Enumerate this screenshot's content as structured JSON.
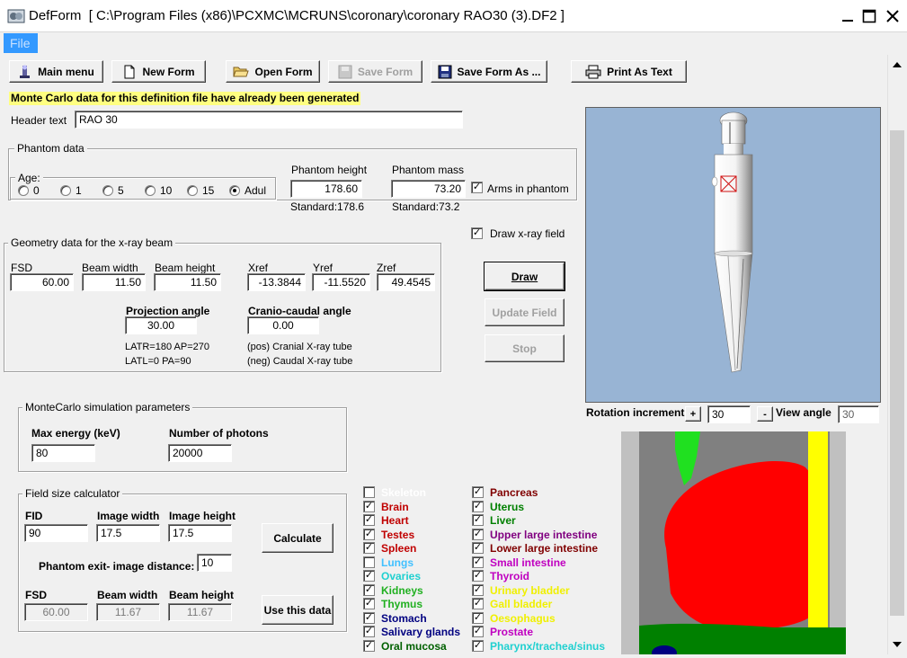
{
  "window": {
    "app_name": "DefForm",
    "path": "[ C:\\Program Files (x86)\\PCXMC\\MCRUNS\\coronary\\coronary RAO30 (3).DF2 ]"
  },
  "menu": {
    "file": "File"
  },
  "toolbar": {
    "main_menu": "Main menu",
    "new_form": "New Form",
    "open_form": "Open Form",
    "save_form": "Save Form",
    "save_form_as": "Save Form As ...",
    "print_as_text": "Print As Text"
  },
  "notice": "Monte Carlo data for this definition file have already been  generated",
  "header": {
    "label": "Header text",
    "value": "RAO 30"
  },
  "phantom": {
    "group_label": "Phantom data",
    "age_label": "Age:",
    "ages": [
      {
        "label": "0",
        "selected": false
      },
      {
        "label": "1",
        "selected": false
      },
      {
        "label": "5",
        "selected": false
      },
      {
        "label": "10",
        "selected": false
      },
      {
        "label": "15",
        "selected": false
      },
      {
        "label": "Adul",
        "selected": true
      }
    ],
    "height_label": "Phantom height",
    "height_value": "178.60",
    "height_standard": "Standard:178.6",
    "mass_label": "Phantom mass",
    "mass_value": "73.20",
    "mass_standard": "Standard:73.2",
    "arms_label": "Arms in phantom",
    "arms_checked": true
  },
  "draw_xray_field": {
    "label": "Draw x-ray field",
    "checked": true
  },
  "geometry": {
    "group_label": "Geometry data for the x-ray beam",
    "fsd_label": "FSD",
    "fsd_value": "60.00",
    "beam_width_label": "Beam width",
    "beam_width_value": "11.50",
    "beam_height_label": "Beam height",
    "beam_height_value": "11.50",
    "xref_label": "Xref",
    "xref_value": "-13.3844",
    "yref_label": "Yref",
    "yref_value": "-11.5520",
    "zref_label": "Zref",
    "zref_value": "49.4545",
    "proj_label": "Projection angle",
    "proj_value": "30.00",
    "cc_label": "Cranio-caudal angle",
    "cc_value": "0.00",
    "note1": "LATR=180  AP=270",
    "note2": "LATL=0      PA=90",
    "note3": "(pos) Cranial X-ray tube",
    "note4": "(neg) Caudal X-ray tube"
  },
  "buttons": {
    "draw": "Draw",
    "update_field": "Update Field",
    "stop": "Stop"
  },
  "view": {
    "rotation_label": "Rotation increment",
    "plus": "+",
    "rotation_value": "30",
    "minus": "-",
    "view_angle_label": "View angle",
    "view_angle_value": "30",
    "bg_color": "#98b4d4"
  },
  "montecarlo": {
    "group_label": "MonteCarlo simulation parameters",
    "energy_label": "Max energy (keV)",
    "energy_value": "80",
    "photons_label": "Number of photons",
    "photons_value": "20000"
  },
  "fieldsize": {
    "group_label": "Field size calculator",
    "fid_label": "FID",
    "fid_value": "90",
    "img_w_label": "Image width",
    "img_w_value": "17.5",
    "img_h_label": "Image height",
    "img_h_value": "17.5",
    "calculate": "Calculate",
    "exit_label": "Phantom exit- image distance:",
    "exit_value": "10",
    "fsd_label": "FSD",
    "fsd_value": "60.00",
    "bw_label": "Beam width",
    "bw_value": "11.67",
    "bh_label": "Beam height",
    "bh_value": "11.67",
    "use_data": "Use this data"
  },
  "organs_left": [
    {
      "name": "Skeleton",
      "color": "#ffffff",
      "checked": false
    },
    {
      "name": "Brain",
      "color": "#c00000",
      "checked": true
    },
    {
      "name": "Heart",
      "color": "#c00000",
      "checked": true
    },
    {
      "name": "Testes",
      "color": "#c00000",
      "checked": true
    },
    {
      "name": "Spleen",
      "color": "#c00000",
      "checked": true
    },
    {
      "name": "Lungs",
      "color": "#40c0ff",
      "checked": false
    },
    {
      "name": "Ovaries",
      "color": "#20d0d0",
      "checked": true
    },
    {
      "name": "Kidneys",
      "color": "#20b020",
      "checked": true
    },
    {
      "name": "Thymus",
      "color": "#20b020",
      "checked": true
    },
    {
      "name": "Stomach",
      "color": "#000080",
      "checked": true
    },
    {
      "name": "Salivary glands",
      "color": "#000080",
      "checked": true
    },
    {
      "name": "Oral mucosa",
      "color": "#006000",
      "checked": true
    }
  ],
  "organs_right": [
    {
      "name": "Pancreas",
      "color": "#800000",
      "checked": true
    },
    {
      "name": "Uterus",
      "color": "#008000",
      "checked": true
    },
    {
      "name": "Liver",
      "color": "#008000",
      "checked": true
    },
    {
      "name": "Upper large intestine",
      "color": "#800080",
      "checked": true
    },
    {
      "name": "Lower large intestine",
      "color": "#800000",
      "checked": true
    },
    {
      "name": "Small intestine",
      "color": "#c000c0",
      "checked": true
    },
    {
      "name": "Thyroid",
      "color": "#c000c0",
      "checked": true
    },
    {
      "name": "Urinary bladder",
      "color": "#f0f000",
      "checked": true
    },
    {
      "name": "Gall bladder",
      "color": "#f0f000",
      "checked": true
    },
    {
      "name": "Oesophagus",
      "color": "#f0f000",
      "checked": true
    },
    {
      "name": "Prostate",
      "color": "#c000c0",
      "checked": true
    },
    {
      "name": "Pharynx/trachea/sinus",
      "color": "#20d0d0",
      "checked": true
    }
  ]
}
